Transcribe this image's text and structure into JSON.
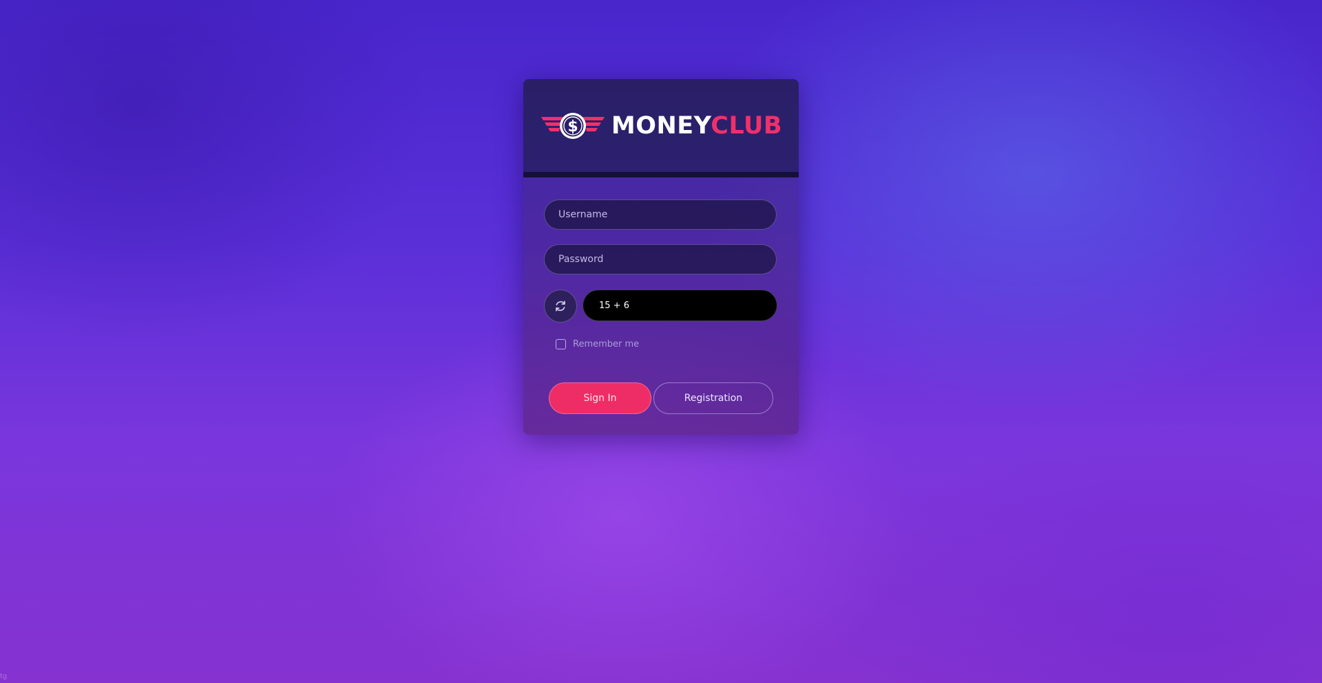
{
  "brand": {
    "word1": "MONEY",
    "word2": "CLUB",
    "logo_icon": "winged-dollar-coin-icon",
    "accent_color": "#f0306a"
  },
  "login_form": {
    "username_placeholder": "Username",
    "password_placeholder": "Password",
    "captcha_text": "15 + 6",
    "refresh_icon": "refresh-icon",
    "remember_label": "Remember me",
    "remember_checked": false,
    "signin_label": "Sign In",
    "registration_label": "Registration"
  },
  "footer": {
    "corner_text": "tg"
  }
}
